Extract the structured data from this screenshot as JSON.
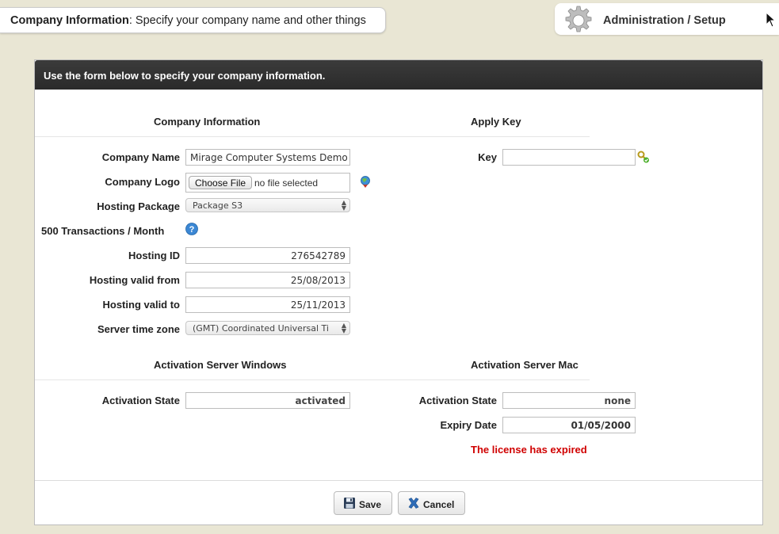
{
  "topbar": {
    "title_bold": "Company Information",
    "title_rest": ": Specify your company name and other things",
    "admin_label": "Administration / Setup",
    "gear_icon": "gear-icon"
  },
  "panel": {
    "header": "Use the form below to specify your company information."
  },
  "company_info": {
    "section_title": "Company Information",
    "company_name_label": "Company Name",
    "company_name_value": "Mirage Computer Systems Demo Se",
    "company_logo_label": "Company Logo",
    "choose_file_label": "Choose File",
    "file_status": "no file selected",
    "hosting_package_label": "Hosting Package",
    "hosting_package_value": "Package S3",
    "transactions_label": "500 Transactions / Month",
    "hosting_id_label": "Hosting ID",
    "hosting_id_value": "276542789",
    "valid_from_label": "Hosting valid from",
    "valid_from_value": "25/08/2013",
    "valid_to_label": "Hosting valid to",
    "valid_to_value": "25/11/2013",
    "timezone_label": "Server time zone",
    "timezone_value": "(GMT) Coordinated Universal Ti"
  },
  "apply_key": {
    "section_title": "Apply Key",
    "key_label": "Key",
    "key_value": ""
  },
  "activation_windows": {
    "section_title": "Activation Server Windows",
    "state_label": "Activation State",
    "state_value": "activated"
  },
  "activation_mac": {
    "section_title": "Activation Server Mac",
    "state_label": "Activation State",
    "state_value": "none",
    "expiry_label": "Expiry Date",
    "expiry_value": "01/05/2000",
    "expired_message": "The license has expired"
  },
  "buttons": {
    "save_label": "Save",
    "cancel_label": "Cancel"
  },
  "colors": {
    "background": "#e9e6d4",
    "header_bar": "#2f2f2f",
    "error_red": "#d00000"
  }
}
